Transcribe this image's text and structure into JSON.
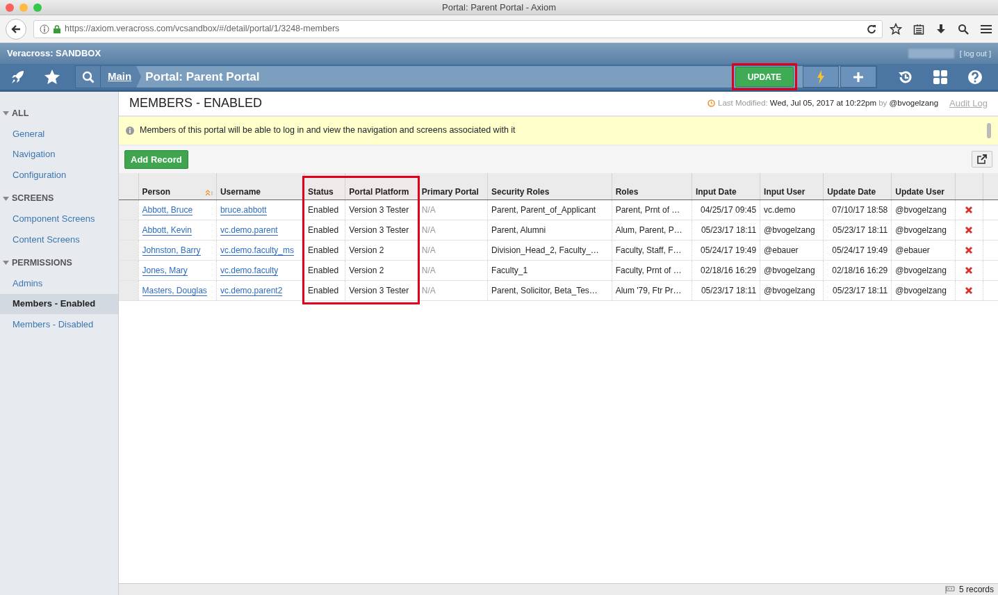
{
  "window": {
    "title": "Portal: Parent Portal - Axiom"
  },
  "browser": {
    "url": "https://axiom.veracross.com/vcsandbox/#/detail/portal/1/3248-members"
  },
  "app_header": {
    "title": "Veracross: SANDBOX",
    "logout": "[ log out ]"
  },
  "navbar": {
    "breadcrumb": "Main",
    "page_title": "Portal: Parent Portal",
    "update_button": {
      "label": "UPDATE",
      "highlighted": true
    }
  },
  "sidebar": {
    "groups": [
      {
        "label": "ALL",
        "expanded": true,
        "items": [
          {
            "label": "General",
            "selected": false
          },
          {
            "label": "Navigation",
            "selected": false
          },
          {
            "label": "Configuration",
            "selected": false
          }
        ]
      },
      {
        "label": "SCREENS",
        "expanded": true,
        "items": [
          {
            "label": "Component Screens",
            "selected": false
          },
          {
            "label": "Content Screens",
            "selected": false
          }
        ]
      },
      {
        "label": "PERMISSIONS",
        "expanded": true,
        "items": [
          {
            "label": "Admins",
            "selected": false
          },
          {
            "label": "Members - Enabled",
            "selected": true
          },
          {
            "label": "Members - Disabled",
            "selected": false
          }
        ]
      }
    ]
  },
  "content": {
    "heading": "MEMBERS - ENABLED",
    "last_modified_label": "Last Modified:",
    "last_modified": "Wed, Jul 05, 2017 at 10:22pm",
    "by": "by",
    "modified_by": "@bvogelzang",
    "audit_log": "Audit Log",
    "info": "Members of this portal will be able to log in and view the navigation and screens associated with it",
    "add_button": "Add Record"
  },
  "table": {
    "columns": [
      {
        "label": "Person",
        "kind": "link",
        "sorted": true,
        "highlighted": false
      },
      {
        "label": "Username",
        "kind": "link",
        "sorted": false,
        "highlighted": false
      },
      {
        "label": "Status",
        "kind": "text",
        "sorted": false,
        "highlighted": true
      },
      {
        "label": "Portal Platform",
        "kind": "text",
        "sorted": false,
        "highlighted": true
      },
      {
        "label": "Primary Portal",
        "kind": "muted",
        "sorted": false,
        "highlighted": false
      },
      {
        "label": "Security Roles",
        "kind": "text",
        "sorted": false,
        "highlighted": false
      },
      {
        "label": "Roles",
        "kind": "text",
        "sorted": false,
        "highlighted": false
      },
      {
        "label": "Input Date",
        "kind": "date",
        "sorted": false,
        "highlighted": false
      },
      {
        "label": "Input User",
        "kind": "text",
        "sorted": false,
        "highlighted": false
      },
      {
        "label": "Update Date",
        "kind": "date",
        "sorted": false,
        "highlighted": false
      },
      {
        "label": "Update User",
        "kind": "text",
        "sorted": false,
        "highlighted": false
      }
    ],
    "rows": [
      {
        "cells": [
          "Abbott, Bruce",
          "bruce.abbott",
          "Enabled",
          "Version 3 Tester",
          "N/A",
          "Parent, Parent_of_Applicant",
          "Parent, Prnt of …",
          "04/25/17 09:45",
          "vc.demo",
          "07/10/17 18:58",
          "@bvogelzang"
        ]
      },
      {
        "cells": [
          "Abbott, Kevin",
          "vc.demo.parent",
          "Enabled",
          "Version 3 Tester",
          "N/A",
          "Parent, Alumni",
          "Alum, Parent, P…",
          "05/23/17 18:11",
          "@bvogelzang",
          "05/23/17 18:11",
          "@bvogelzang"
        ]
      },
      {
        "cells": [
          "Johnston, Barry",
          "vc.demo.faculty_ms",
          "Enabled",
          "Version 2",
          "N/A",
          "Division_Head_2, Faculty_…",
          "Faculty, Staff, F…",
          "05/24/17 19:49",
          "@ebauer",
          "05/24/17 19:49",
          "@ebauer"
        ]
      },
      {
        "cells": [
          "Jones, Mary",
          "vc.demo.faculty",
          "Enabled",
          "Version 2",
          "N/A",
          "Faculty_1",
          "Faculty, Prnt of …",
          "02/18/16 16:29",
          "@bvogelzang",
          "02/18/16 16:29",
          "@bvogelzang"
        ]
      },
      {
        "cells": [
          "Masters, Douglas",
          "vc.demo.parent2",
          "Enabled",
          "Version 3 Tester",
          "N/A",
          "Parent, Solicitor, Beta_Tes…",
          "Alum '79, Ftr Pr…",
          "05/23/17 18:11",
          "@bvogelzang",
          "05/23/17 18:11",
          "@bvogelzang"
        ]
      }
    ]
  },
  "status_bar": {
    "count": "5 records"
  }
}
